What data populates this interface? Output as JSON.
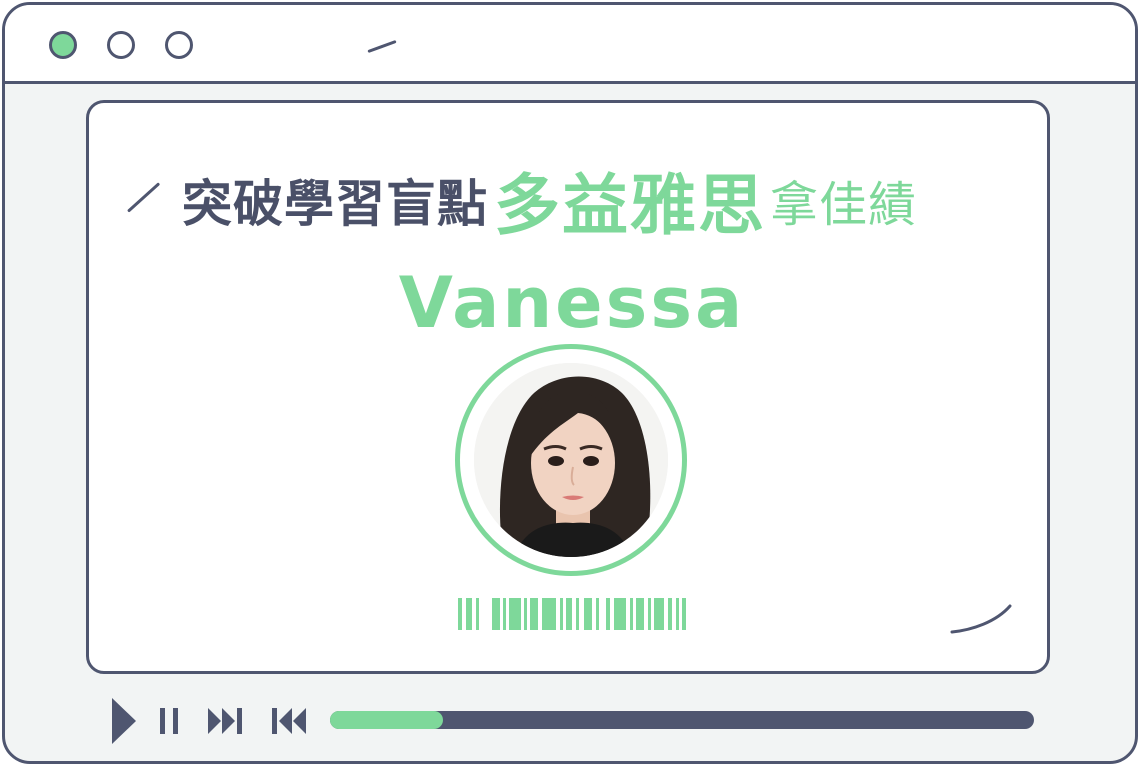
{
  "window": {
    "traffic_lights": [
      "close",
      "minimize",
      "maximize"
    ]
  },
  "headline": {
    "part1": "突破學習盲點",
    "part2": "多益雅思",
    "part3": "拿佳績"
  },
  "profile": {
    "name": "Vanessa"
  },
  "player": {
    "progress": 0.16
  },
  "colors": {
    "accent": "#7ed89a",
    "ink": "#4f5670",
    "background": "#f2f4f4"
  },
  "icons": [
    "play-icon",
    "pause-icon",
    "fast-forward-icon",
    "rewind-icon",
    "barcode-icon"
  ]
}
